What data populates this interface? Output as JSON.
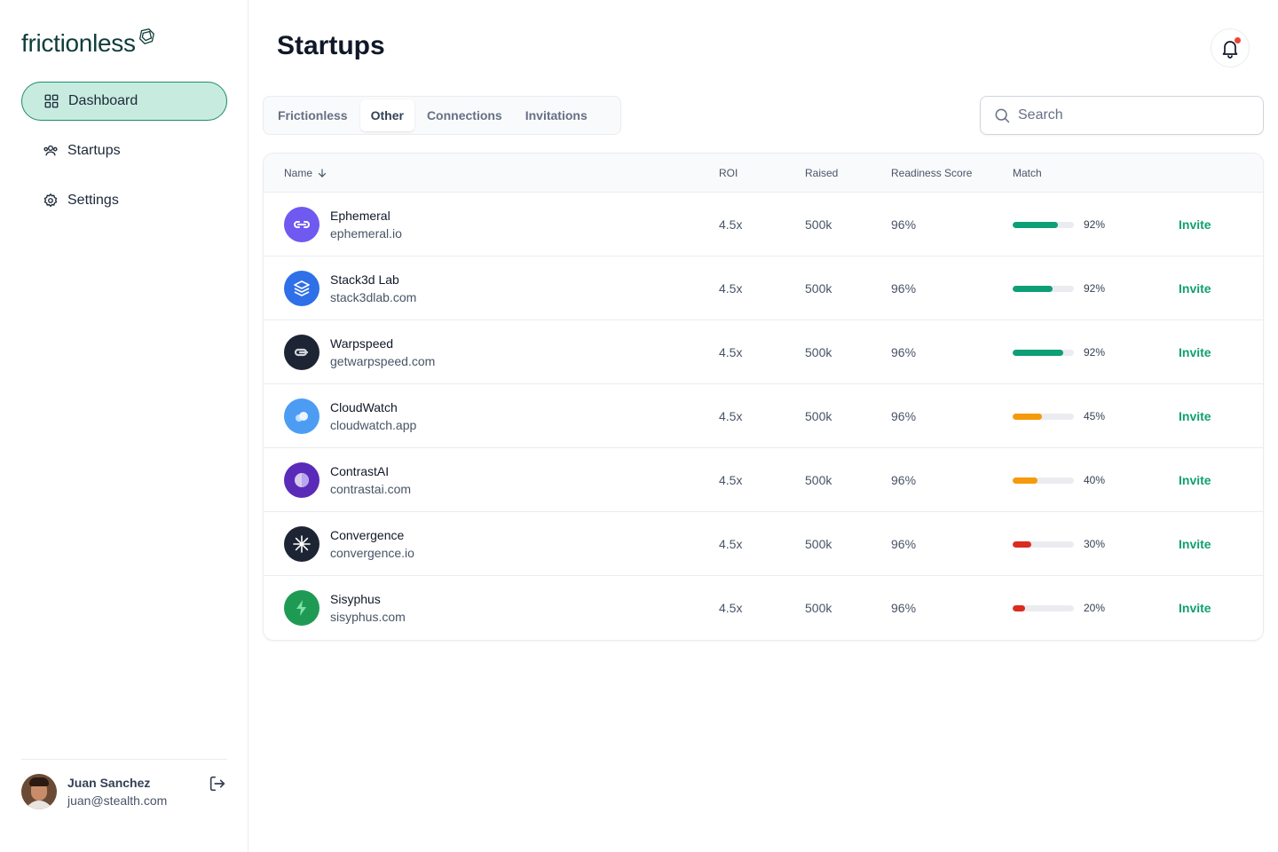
{
  "brand": {
    "name": "frictionless"
  },
  "sidebar": {
    "items": [
      {
        "label": "Dashboard",
        "active": true,
        "icon": "grid-icon"
      },
      {
        "label": "Startups",
        "active": false,
        "icon": "users-icon"
      },
      {
        "label": "Settings",
        "active": false,
        "icon": "gear-icon"
      }
    ],
    "user": {
      "name": "Juan Sanchez",
      "email": "juan@stealth.com"
    }
  },
  "header": {
    "title": "Startups",
    "notification_dot": true
  },
  "tabs": [
    {
      "label": "Frictionless",
      "active": false
    },
    {
      "label": "Other",
      "active": true
    },
    {
      "label": "Connections",
      "active": false
    },
    {
      "label": "Invitations",
      "active": false
    }
  ],
  "search": {
    "placeholder": "Search",
    "value": ""
  },
  "table": {
    "columns": {
      "name": "Name",
      "roi": "ROI",
      "raised": "Raised",
      "readiness": "Readiness Score",
      "match": "Match"
    },
    "sort": {
      "column": "Name",
      "direction": "descending"
    },
    "rows": [
      {
        "name": "Ephemeral",
        "url": "ephemeral.io",
        "roi": "4.5x",
        "raised": "500k",
        "readiness": "96%",
        "match": "92%",
        "match_value": 0.74,
        "match_color": "#0e9f77",
        "logo_color": "#6e5af0",
        "logo_icon": "link-icon",
        "action": "Invite"
      },
      {
        "name": "Stack3d Lab",
        "url": "stack3dlab.com",
        "roi": "4.5x",
        "raised": "500k",
        "readiness": "96%",
        "match": "92%",
        "match_value": 0.65,
        "match_color": "#0e9f77",
        "logo_color": "#2f6fe8",
        "logo_icon": "layers-icon",
        "action": "Invite"
      },
      {
        "name": "Warpspeed",
        "url": "getwarpspeed.com",
        "roi": "4.5x",
        "raised": "500k",
        "readiness": "96%",
        "match": "92%",
        "match_value": 0.83,
        "match_color": "#0e9f77",
        "logo_color": "#1d2433",
        "logo_icon": "chain-icon",
        "action": "Invite"
      },
      {
        "name": "CloudWatch",
        "url": "cloudwatch.app",
        "roi": "4.5x",
        "raised": "500k",
        "readiness": "96%",
        "match": "45%",
        "match_value": 0.48,
        "match_color": "#f59a0b",
        "logo_color": "#4d9cf4",
        "logo_icon": "cloud-icon",
        "action": "Invite"
      },
      {
        "name": "ContrastAI",
        "url": "contrastai.com",
        "roi": "4.5x",
        "raised": "500k",
        "readiness": "96%",
        "match": "40%",
        "match_value": 0.4,
        "match_color": "#f59a0b",
        "logo_color": "#5a2bb8",
        "logo_icon": "half-circle-icon",
        "action": "Invite"
      },
      {
        "name": "Convergence",
        "url": "convergence.io",
        "roi": "4.5x",
        "raised": "500k",
        "readiness": "96%",
        "match": "30%",
        "match_value": 0.3,
        "match_color": "#d92d20",
        "logo_color": "#1d2433",
        "logo_icon": "starburst-icon",
        "action": "Invite"
      },
      {
        "name": "Sisyphus",
        "url": "sisyphus.com",
        "roi": "4.5x",
        "raised": "500k",
        "readiness": "96%",
        "match": "20%",
        "match_value": 0.2,
        "match_color": "#d92d20",
        "logo_color": "#1f9a55",
        "logo_icon": "bolt-icon",
        "action": "Invite"
      }
    ]
  }
}
